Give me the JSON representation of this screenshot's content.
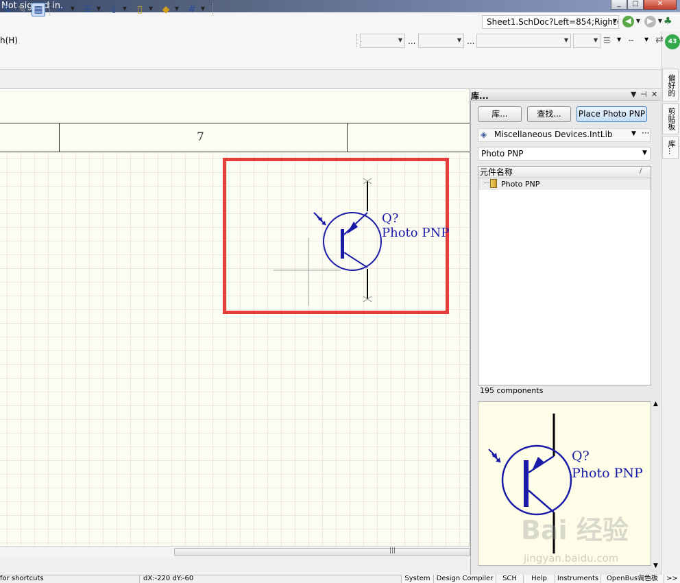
{
  "title_bar": {
    "title": "Not signed in."
  },
  "toolbar": {
    "address": "Sheet1.SchDoc?Left=854;Right="
  },
  "menu": {
    "help": "h(H)"
  },
  "canvas": {
    "zone_label": "7",
    "component": {
      "designator": "Q?",
      "comment": "Photo PNP"
    }
  },
  "library_panel": {
    "title": "库...",
    "buttons": {
      "libraries": "库...",
      "search": "查找...",
      "place": "Place Photo PNP"
    },
    "library_name": "Miscellaneous Devices.IntLib",
    "more": "···",
    "filter_value": "Photo PNP",
    "list_header": "元件名称",
    "list_sort_glyph": "/",
    "items": [
      "Photo PNP"
    ],
    "count": "195 components",
    "preview": {
      "designator": "Q?",
      "comment": "Photo PNP"
    },
    "watermark": "Bai 经验",
    "watermark_url": "jingyan.baidu.com"
  },
  "sidebar_tabs": [
    "偏好的",
    "剪贴板",
    "库..."
  ],
  "sidebar_badge": "43",
  "status_bar": {
    "hint": "for shortcuts",
    "coords": "dX:-220 dY:-60",
    "tabs": [
      "System",
      "Design Compiler",
      "SCH",
      "Help",
      "Instruments",
      "OpenBus调色板",
      ">>"
    ]
  },
  "colors": {
    "highlight": "#e63c3c",
    "schematic_blue": "#1a1aa8",
    "canvas_bg": "#fdfcf3",
    "preview_bg": "#fdfde8"
  }
}
